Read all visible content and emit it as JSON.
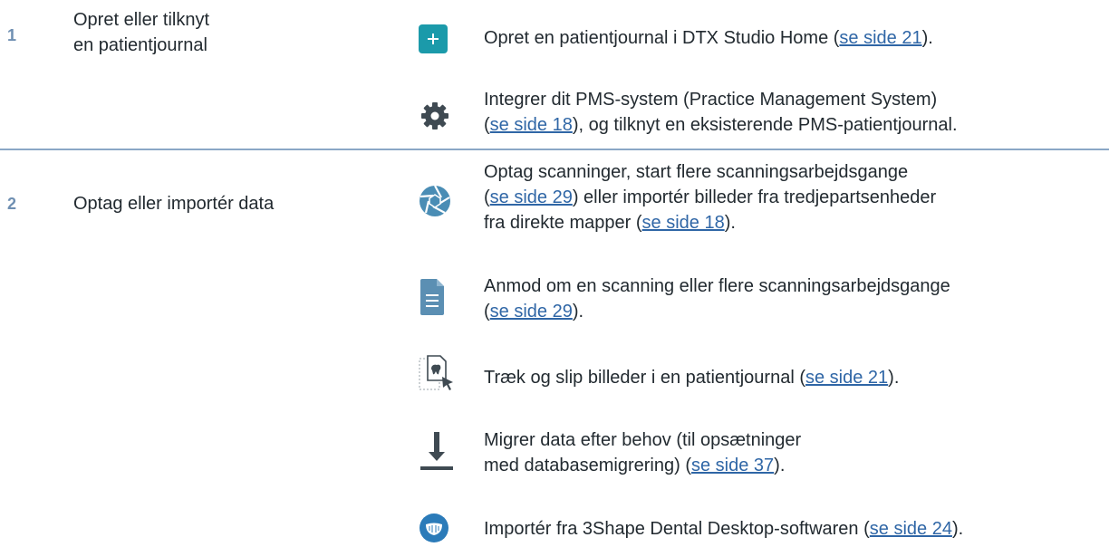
{
  "steps": [
    {
      "number": "1",
      "title_line1": "Opret eller tilknyt",
      "title_line2": "en patientjournal"
    },
    {
      "number": "2",
      "title": "Optag eller importér data"
    }
  ],
  "items": {
    "create_journal": {
      "icon": "plus-icon",
      "text_before": "Opret en patientjournal i DTX Studio Home (",
      "link": "se side 21",
      "text_after": ")."
    },
    "integrate_pms": {
      "icon": "gear-icon",
      "line1": "Integrer dit PMS-system (Practice Management System)",
      "text_before": "(",
      "link": "se side 18",
      "text_after": "), og tilknyt en eksisterende PMS-patientjournal."
    },
    "acquire_scans": {
      "icon": "aperture-icon",
      "line1": "Optag scanninger, start flere scanningsarbejdsgange",
      "l2_before": "(",
      "link1": "se side 29",
      "l2_after": ") eller importér billeder fra tredjepartsenheder",
      "l3_before": "fra direkte mapper (",
      "link2": "se side 18",
      "l3_after": ")."
    },
    "request_scan": {
      "icon": "document-icon",
      "line1": "Anmod om en scanning eller flere scanningsarbejdsgange",
      "text_before": "(",
      "link": "se side 29",
      "text_after": ")."
    },
    "drag_drop": {
      "icon": "drag-drop-icon",
      "text_before": "Træk og slip billeder i en patientjournal (",
      "link": "se side 21",
      "text_after": ")."
    },
    "migrate": {
      "icon": "download-icon",
      "line1": "Migrer data efter behov (til opsætninger",
      "text_before": "med databasemigrering) (",
      "link": "se side 37",
      "text_after": ")."
    },
    "import_3shape": {
      "icon": "dental-arch-icon",
      "text_before": "Importér fra 3Shape Dental Desktop-softwaren (",
      "link": "se side 24",
      "text_after": ")."
    }
  },
  "colors": {
    "accent_teal": "#1b9aaa",
    "icon_gray": "#3f4a52",
    "aperture_blue": "#4a8db5",
    "document_blue": "#5b8fb3",
    "link_blue": "#2f66a6",
    "separator": "#8aa7c6"
  }
}
